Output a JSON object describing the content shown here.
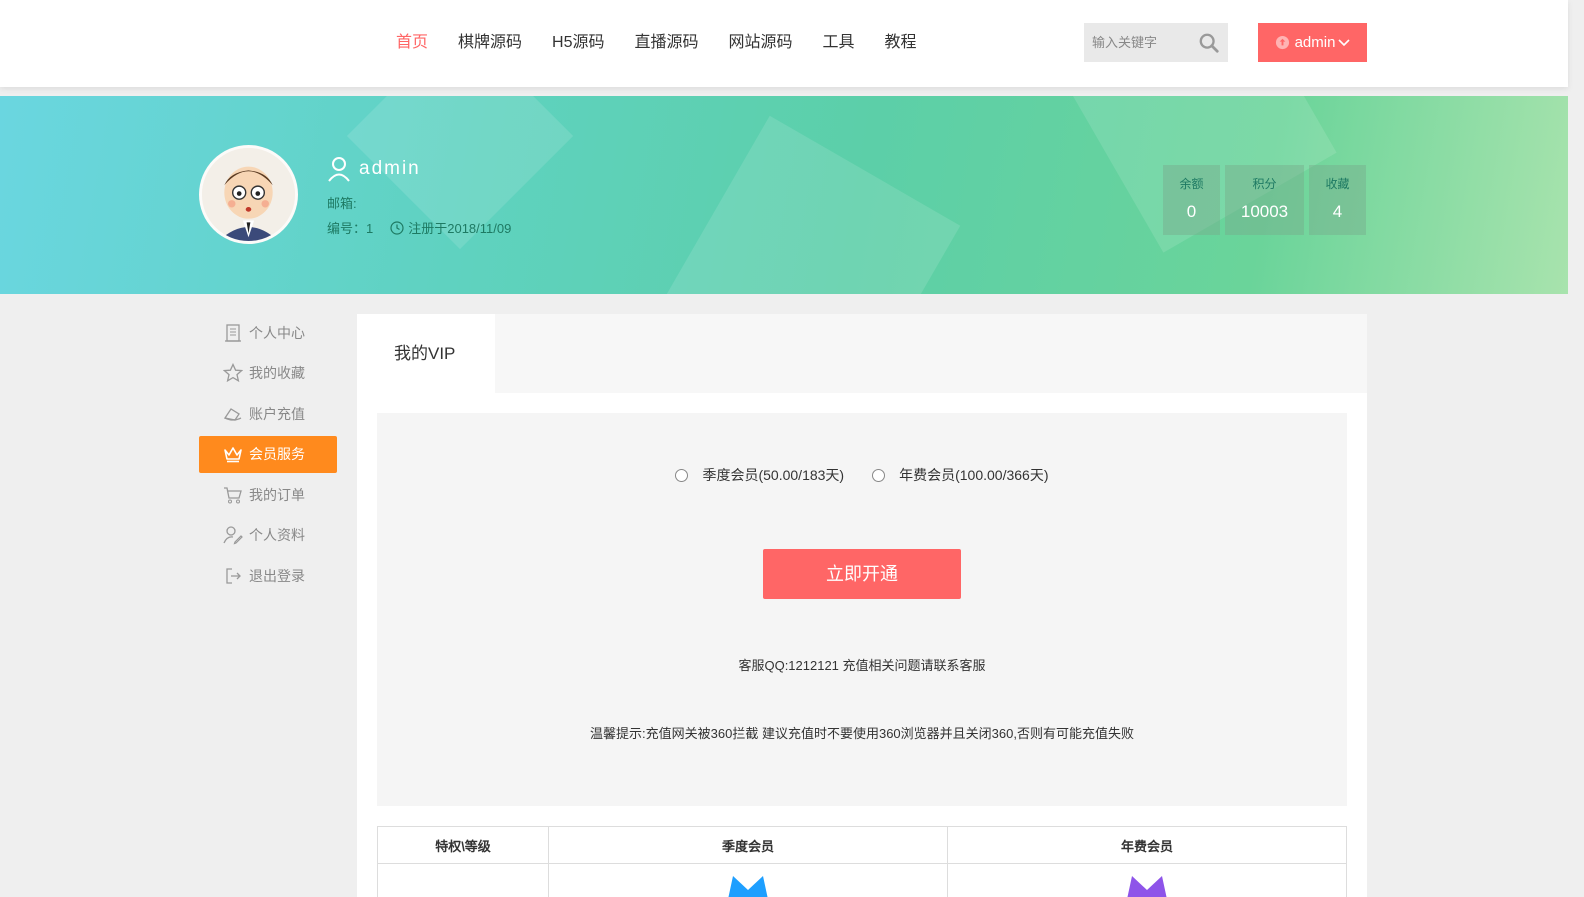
{
  "nav": {
    "items": [
      "首页",
      "棋牌源码",
      "H5源码",
      "直播源码",
      "网站源码",
      "工具",
      "教程"
    ],
    "active_index": 0
  },
  "search": {
    "placeholder": "输入关键字"
  },
  "user_menu": {
    "label": "admin"
  },
  "profile": {
    "username": "admin",
    "email_label": "邮箱:",
    "id_label": "编号：1",
    "registered": "注册于2018/11/09"
  },
  "stats": [
    {
      "label": "余额",
      "value": "0"
    },
    {
      "label": "积分",
      "value": "10003"
    },
    {
      "label": "收藏",
      "value": "4"
    }
  ],
  "sidebar": {
    "items": [
      {
        "label": "个人中心",
        "icon": "building-icon"
      },
      {
        "label": "我的收藏",
        "icon": "star-icon"
      },
      {
        "label": "账户充值",
        "icon": "wallet-icon"
      },
      {
        "label": "会员服务",
        "icon": "crown-icon"
      },
      {
        "label": "我的订单",
        "icon": "cart-icon"
      },
      {
        "label": "个人资料",
        "icon": "user-edit-icon"
      },
      {
        "label": "退出登录",
        "icon": "logout-icon"
      }
    ],
    "active_index": 3
  },
  "main": {
    "tab": "我的VIP",
    "options": [
      "季度会员(50.00/183天)",
      "年费会员(100.00/366天)"
    ],
    "buy_button": "立即开通",
    "qq_text": "客服QQ:1212121 充值相关问题请联系客服",
    "tip_text": "温馨提示:充值网关被360拦截 建议充值时不要使用360浏览器并且关闭360,否则有可能充值失败"
  },
  "table": {
    "headers": [
      "特权\\等级",
      "季度会员",
      "年费会员"
    ]
  },
  "colors": {
    "accent": "#ff6666",
    "sidebar_active": "#ff8a1d",
    "vip_quarter": "#1e9fff",
    "vip_year": "#8e54e9"
  }
}
